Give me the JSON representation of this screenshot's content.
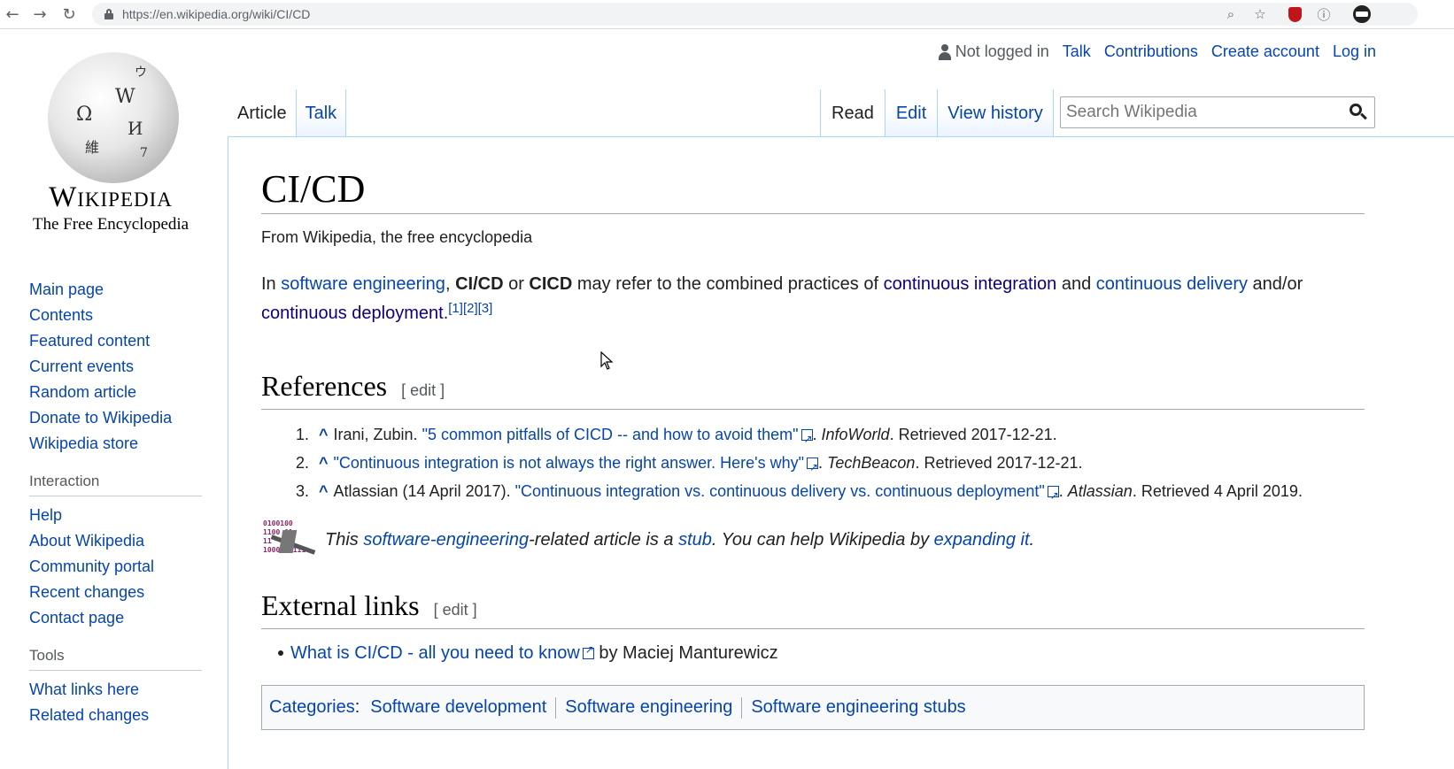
{
  "browser": {
    "url": "https://en.wikipedia.org/wiki/CI/CD",
    "back_icon": "back-arrow-icon",
    "forward_icon": "forward-arrow-icon",
    "reload_icon": "reload-icon"
  },
  "logo": {
    "wordmark": "Wikipedia",
    "tagline": "The Free Encyclopedia"
  },
  "sidebar": {
    "nav": [
      "Main page",
      "Contents",
      "Featured content",
      "Current events",
      "Random article",
      "Donate to Wikipedia",
      "Wikipedia store"
    ],
    "interaction_heading": "Interaction",
    "interaction": [
      "Help",
      "About Wikipedia",
      "Community portal",
      "Recent changes",
      "Contact page"
    ],
    "tools_heading": "Tools",
    "tools": [
      "What links here",
      "Related changes"
    ]
  },
  "user_tools": {
    "not_logged_in": "Not logged in",
    "talk": "Talk",
    "contributions": "Contributions",
    "create_account": "Create account",
    "log_in": "Log in"
  },
  "tabs": {
    "article": "Article",
    "talk": "Talk",
    "read": "Read",
    "edit": "Edit",
    "view_history": "View history"
  },
  "search": {
    "placeholder": "Search Wikipedia"
  },
  "article": {
    "title": "CI/CD",
    "sitesub": "From Wikipedia, the free encyclopedia",
    "lead": {
      "in": "In ",
      "link1": "software engineering",
      "comma": ", ",
      "bold1": "CI/CD",
      "or": " or ",
      "bold2": "CICD",
      "mid": " may refer to the combined practices of ",
      "link2": "continuous integration",
      "and": " and ",
      "link3": "continuous delivery",
      "andor": " and/or ",
      "link4": "continuous deployment",
      "period": ".",
      "cite1": "[1]",
      "cite2": "[2]",
      "cite3": "[3]"
    },
    "references_heading": "References",
    "edit_label": "[ edit ]",
    "references": [
      {
        "num": "1.",
        "author": "Irani, Zubin. ",
        "title": "\"5 common pitfalls of CICD -- and how to avoid them\"",
        "sep": ". ",
        "work": "InfoWorld",
        "retrieved": ". Retrieved 2017-12-21."
      },
      {
        "num": "2.",
        "author": "",
        "title": "\"Continuous integration is not always the right answer. Here's why\"",
        "sep": ". ",
        "work": "TechBeacon",
        "retrieved": ". Retrieved 2017-12-21."
      },
      {
        "num": "3.",
        "author": "Atlassian (14 April 2017). ",
        "title": "\"Continuous integration vs. continuous delivery vs. continuous deployment\"",
        "sep": ". ",
        "work": "Atlassian",
        "retrieved": ". Retrieved 4 April 2019."
      }
    ],
    "stub": {
      "this": "This ",
      "link1": "software-engineering",
      "mid": "-related article is a ",
      "link2": "stub",
      "mid2": ". You can help Wikipedia by ",
      "link3": "expanding it",
      "end": ".",
      "image_text": "0100100\n1100 01\n11  1\n1000110111"
    },
    "external_heading": "External links",
    "external": {
      "link": "What is CI/CD - all you need to know",
      "by": " by Maciej Manturewicz"
    },
    "categories_label": "Categories",
    "categories": [
      "Software development",
      "Software engineering",
      "Software engineering stubs"
    ]
  },
  "colors": {
    "link": "#0645ad",
    "visited": "#0b0080",
    "border": "#a7d7f9"
  }
}
